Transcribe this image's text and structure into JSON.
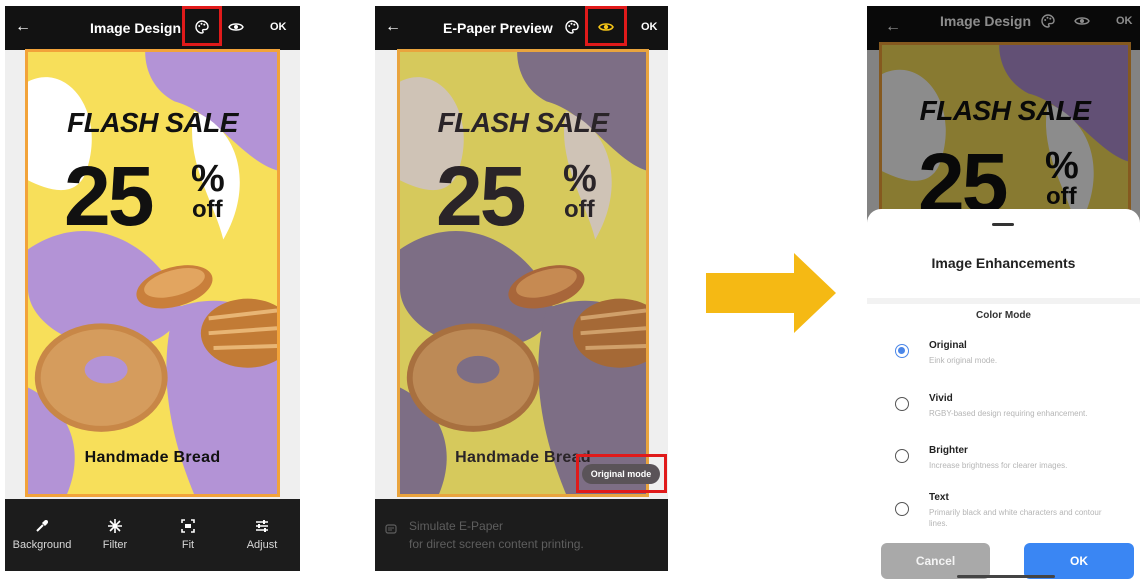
{
  "colors": {
    "topbar_bg": "#121212",
    "highlight_box": "#e01a1a",
    "poster_border": "#f2a33a",
    "poster_yellow": "#f7df5a",
    "poster_purple": "#b393d6",
    "arrow": "#f5b914",
    "accent_blue": "#3a86f3",
    "eye_active": "#f5c518"
  },
  "screen1": {
    "title": "Image Design",
    "ok_label": "OK",
    "icons": [
      "back-arrow-icon",
      "palette-icon",
      "eye-icon"
    ],
    "poster": {
      "headline": "FLASH SALE",
      "number": "25",
      "percent": "%",
      "off": "off",
      "caption": "Handmade Bread"
    },
    "toolbar": [
      {
        "label": "Background",
        "icon": "eyedropper-icon"
      },
      {
        "label": "Filter",
        "icon": "filter-icon"
      },
      {
        "label": "Fit",
        "icon": "fit-icon"
      },
      {
        "label": "Adjust",
        "icon": "sliders-icon"
      }
    ]
  },
  "screen2": {
    "title": "E-Paper Preview",
    "ok_label": "OK",
    "icons": [
      "back-arrow-icon",
      "palette-icon",
      "eye-icon"
    ],
    "poster": {
      "headline": "FLASH SALE",
      "number": "25",
      "percent": "%",
      "off": "off",
      "caption": "Handmade Bread"
    },
    "mode_badge": "Original mode",
    "simulate_line1": "Simulate E-Paper",
    "simulate_line2": "for direct screen content printing."
  },
  "screen3": {
    "title": "Image Design",
    "ok_label": "OK",
    "poster": {
      "headline": "FLASH SALE",
      "number": "25",
      "percent": "%",
      "off": "off"
    },
    "sheet": {
      "title": "Image Enhancements",
      "section": "Color Mode",
      "options": [
        {
          "name": "Original",
          "desc": "Eink original mode.",
          "selected": true
        },
        {
          "name": "Vivid",
          "desc": "RGBY-based design requiring enhancement.",
          "selected": false
        },
        {
          "name": "Brighter",
          "desc": "Increase brightness for clearer images.",
          "selected": false
        },
        {
          "name": "Text",
          "desc": "Primarily black and white characters and contour lines.",
          "selected": false
        }
      ],
      "cancel_label": "Cancel",
      "ok_label": "OK"
    }
  }
}
